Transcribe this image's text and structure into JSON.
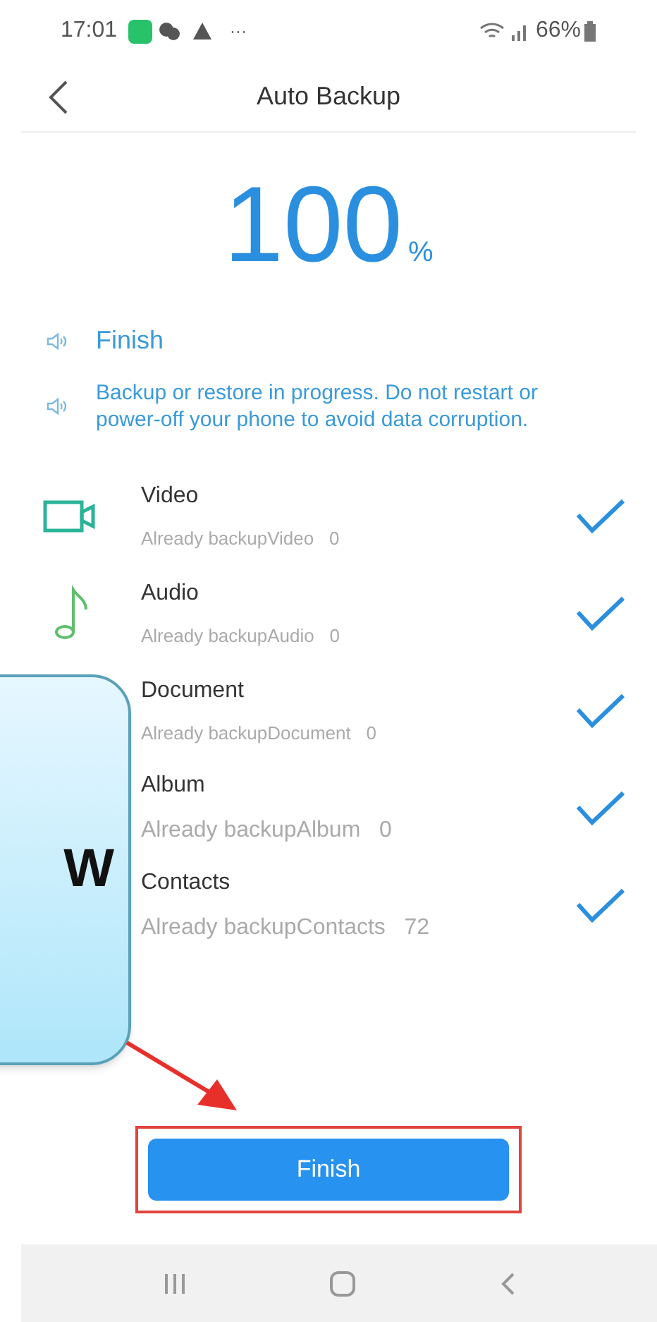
{
  "status_bar": {
    "time": "17:01",
    "more": "···",
    "battery": "66%"
  },
  "header": {
    "title": "Auto Backup"
  },
  "progress": {
    "value": "100",
    "unit": "%"
  },
  "notices": [
    {
      "text": "Finish",
      "kind": "status"
    },
    {
      "text": "Backup or restore in progress. Do not restart or power-off your phone to avoid data corruption.",
      "kind": "warning"
    }
  ],
  "items": [
    {
      "kind": "video",
      "name": "Video",
      "detail": "Already backupVideo",
      "count": "0",
      "checked": true
    },
    {
      "kind": "audio",
      "name": "Audio",
      "detail": "Already backupAudio",
      "count": "0",
      "checked": true
    },
    {
      "name": "Document",
      "detail": "Already backupDocument",
      "count": "0",
      "checked": true
    },
    {
      "name": "Album",
      "detail": "Already backupAlbum",
      "count": "0",
      "checked": true
    },
    {
      "name": "Contacts",
      "detail": "Already backupContacts",
      "count": "72",
      "checked": true
    }
  ],
  "callout": {
    "text": "W"
  },
  "button": {
    "label": "Finish"
  }
}
